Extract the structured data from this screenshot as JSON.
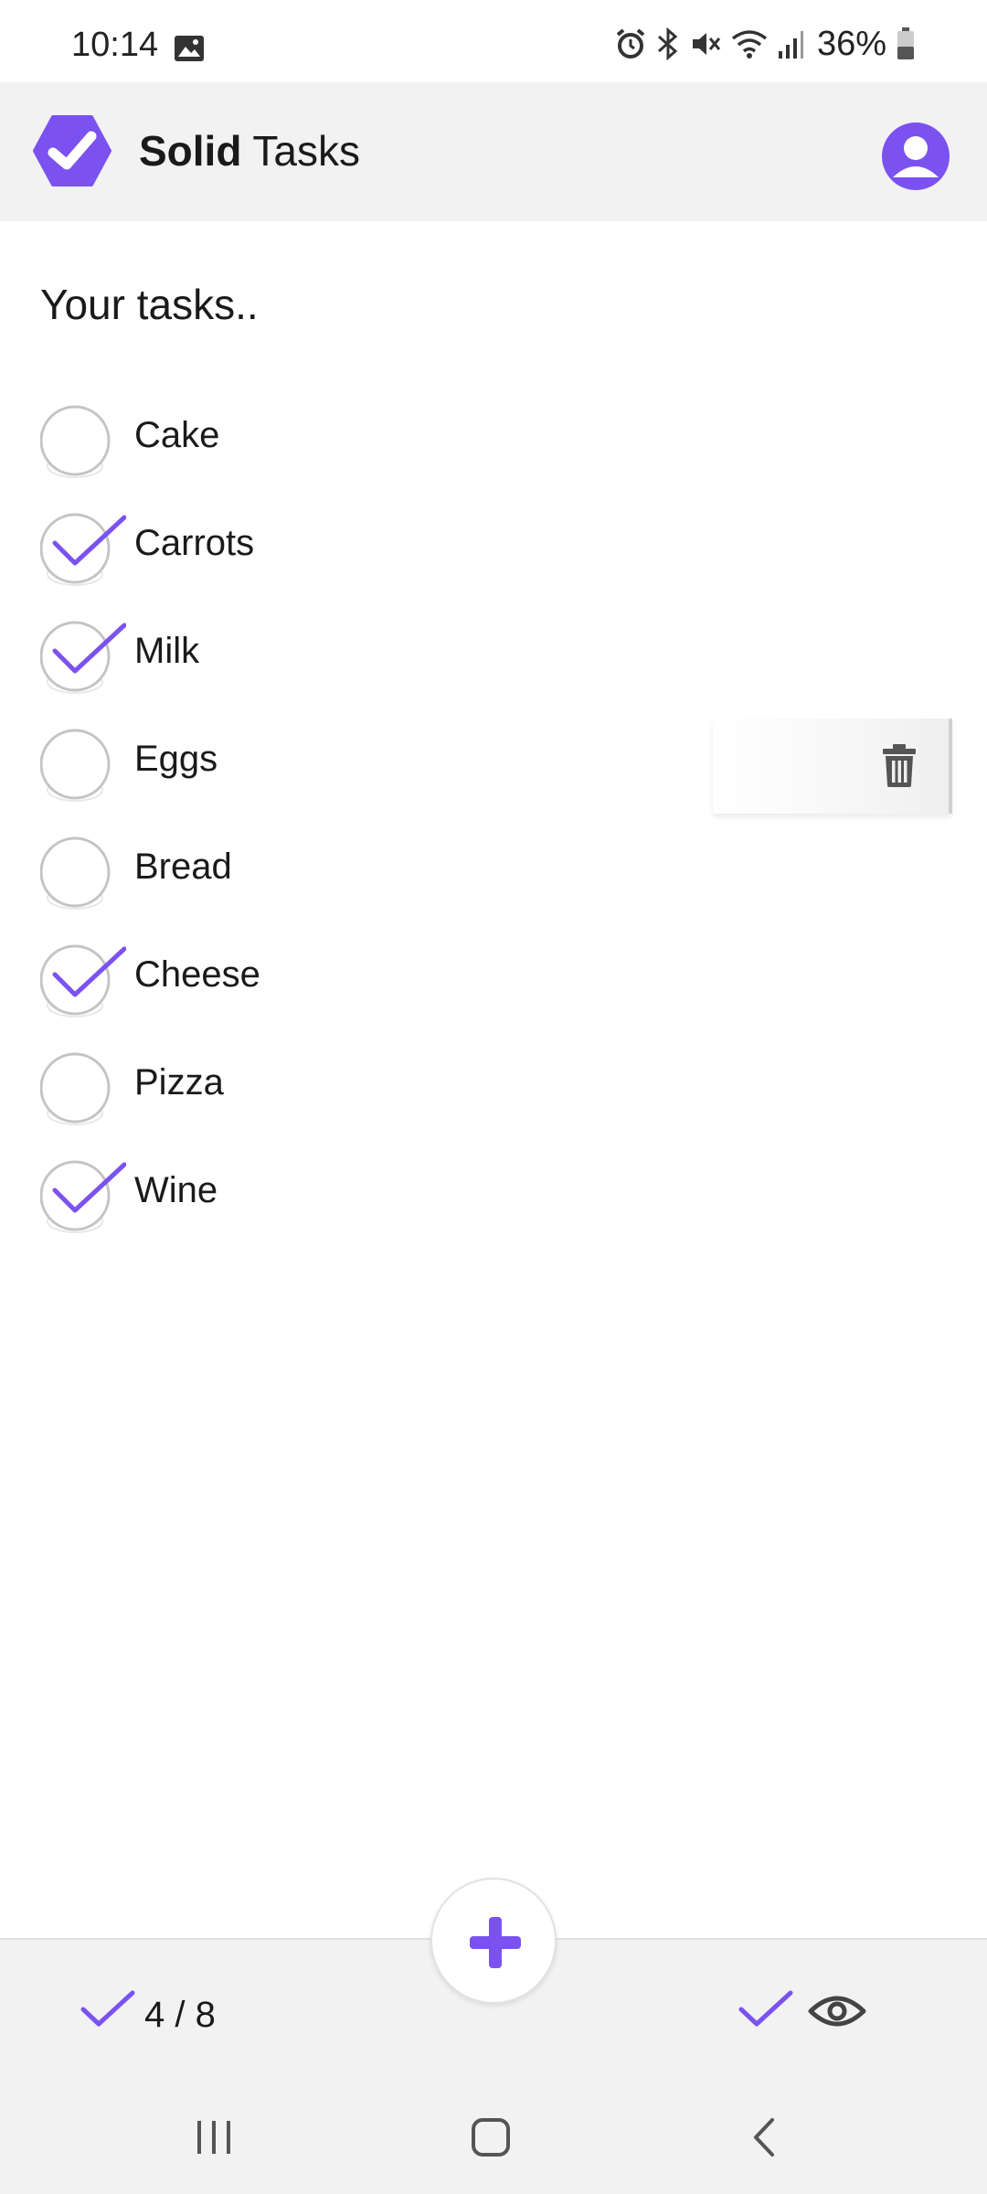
{
  "status_bar": {
    "time": "10:14",
    "battery": "36%",
    "icons": [
      "gallery-icon",
      "alarm-icon",
      "bluetooth-icon",
      "mute-icon",
      "wifi-icon",
      "signal-icon",
      "battery-icon"
    ]
  },
  "header": {
    "title_bold": "Solid",
    "title_rest": " Tasks",
    "logo_icon": "hexagon-check-logo",
    "profile_icon": "user-avatar-icon"
  },
  "main": {
    "heading": "Your tasks..",
    "tasks": [
      {
        "label": "Cake",
        "done": false
      },
      {
        "label": "Carrots",
        "done": true
      },
      {
        "label": "Milk",
        "done": true
      },
      {
        "label": "Eggs",
        "done": false
      },
      {
        "label": "Bread",
        "done": false
      },
      {
        "label": "Cheese",
        "done": true
      },
      {
        "label": "Pizza",
        "done": false
      },
      {
        "label": "Wine",
        "done": true
      }
    ],
    "delete_icon": "trash-icon"
  },
  "bottom_bar": {
    "counter": "4 / 8",
    "add_icon": "plus-icon",
    "show_completed_icons": [
      "check-icon",
      "eye-icon"
    ]
  },
  "system_nav": {
    "icons": [
      "recents-icon",
      "home-icon",
      "back-icon"
    ]
  },
  "colors": {
    "accent": "#7b52f0",
    "header_bg": "#f2f2f2",
    "circle_stroke": "#c4c4c4",
    "text": "#1a1a1a"
  }
}
